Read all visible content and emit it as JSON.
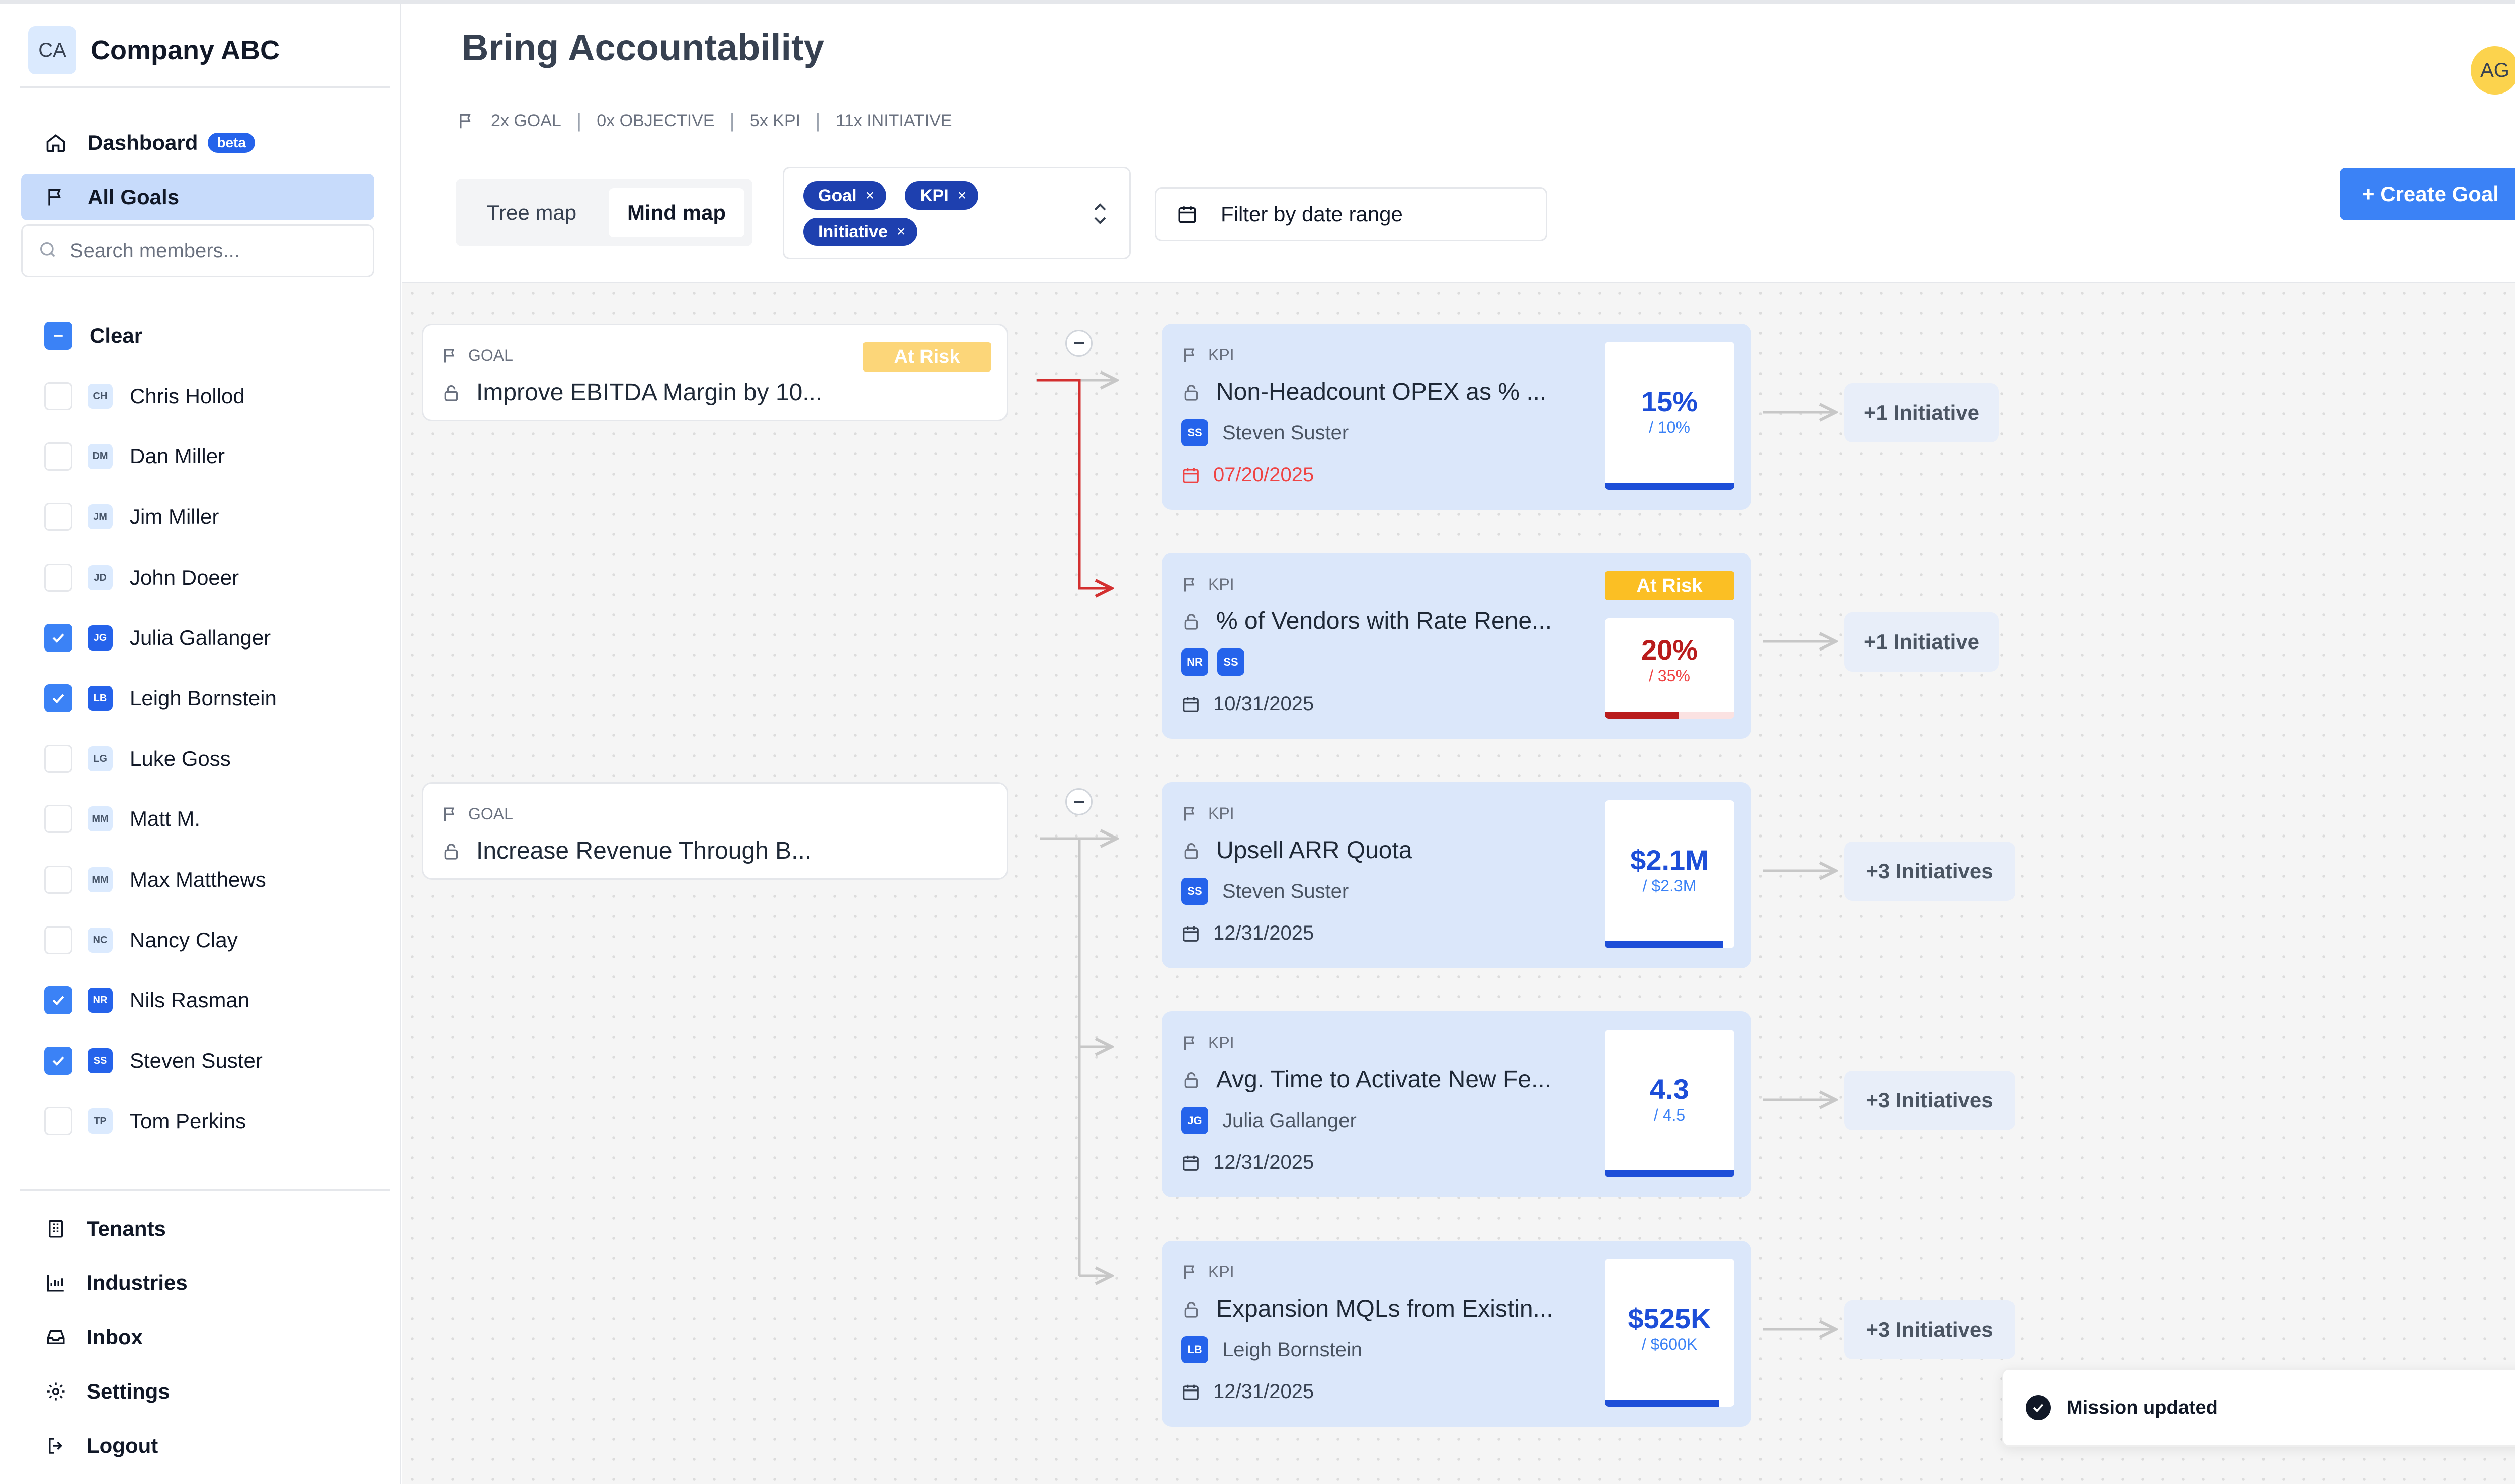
{
  "sidebar": {
    "brand_initials": "CA",
    "brand_name": "Company ABC",
    "nav": [
      {
        "label": "Dashboard",
        "badge": "beta",
        "icon": "home-icon"
      },
      {
        "label": "All Goals",
        "icon": "flag-icon",
        "active": true
      }
    ],
    "search_placeholder": "Search members...",
    "clear_label": "Clear",
    "members": [
      {
        "initials": "CH",
        "name": "Chris Hollod",
        "checked": false
      },
      {
        "initials": "DM",
        "name": "Dan Miller",
        "checked": false
      },
      {
        "initials": "JM",
        "name": "Jim Miller",
        "checked": false
      },
      {
        "initials": "JD",
        "name": "John Doeer",
        "checked": false
      },
      {
        "initials": "JG",
        "name": "Julia Gallanger",
        "checked": true
      },
      {
        "initials": "LB",
        "name": "Leigh Bornstein",
        "checked": true
      },
      {
        "initials": "LG",
        "name": "Luke Goss",
        "checked": false
      },
      {
        "initials": "MM",
        "name": "Matt M.",
        "checked": false
      },
      {
        "initials": "MM",
        "name": "Max Matthews",
        "checked": false
      },
      {
        "initials": "NC",
        "name": "Nancy Clay",
        "checked": false
      },
      {
        "initials": "NR",
        "name": "Nils Rasman",
        "checked": true
      },
      {
        "initials": "SS",
        "name": "Steven Suster",
        "checked": true
      },
      {
        "initials": "TP",
        "name": "Tom Perkins",
        "checked": false
      }
    ],
    "bottom_nav": [
      {
        "label": "Tenants",
        "icon": "building-icon"
      },
      {
        "label": "Industries",
        "icon": "chart-icon"
      },
      {
        "label": "Inbox",
        "icon": "inbox-icon"
      },
      {
        "label": "Settings",
        "icon": "gear-icon"
      },
      {
        "label": "Logout",
        "icon": "logout-icon"
      }
    ]
  },
  "header": {
    "title": "Bring Accountability",
    "counts": [
      "2x GOAL",
      "0x OBJECTIVE",
      "5x KPI",
      "11x INITIATIVE"
    ],
    "user_initials": "AG"
  },
  "toolbar": {
    "views": [
      "Tree map",
      "Mind map"
    ],
    "active_view": "Mind map",
    "type_chips": [
      "Goal",
      "KPI",
      "Initiative"
    ],
    "chip_remove": "×",
    "date_placeholder": "Filter by date range",
    "create_label": "+ Create Goal"
  },
  "goals": [
    {
      "type": "GOAL",
      "title": "Improve EBITDA Margin by 10...",
      "status": "At Risk",
      "status_color": "#fcd679"
    },
    {
      "type": "GOAL",
      "title": "Increase Revenue Through B..."
    }
  ],
  "kpis": [
    {
      "type": "KPI",
      "title": "Non-Headcount OPEX as % ...",
      "owners": [
        {
          "initials": "SS",
          "name": "Steven Suster"
        }
      ],
      "due": "07/20/2025",
      "overdue": true,
      "value": "15%",
      "target": "/ 10%",
      "progress": 1.0,
      "tone": "blue",
      "initiatives": "+1 Initiative"
    },
    {
      "type": "KPI",
      "title": "% of Vendors with Rate Rene...",
      "owners": [
        {
          "initials": "NR"
        },
        {
          "initials": "SS"
        }
      ],
      "due": "10/31/2025",
      "status": "At Risk",
      "value": "20%",
      "target": "/ 35%",
      "progress": 0.57,
      "tone": "red",
      "initiatives": "+1 Initiative"
    },
    {
      "type": "KPI",
      "title": "Upsell ARR Quota",
      "owners": [
        {
          "initials": "SS",
          "name": "Steven Suster"
        }
      ],
      "due": "12/31/2025",
      "value": "$2.1M",
      "target": "/ $2.3M",
      "progress": 0.91,
      "tone": "blue",
      "initiatives": "+3 Initiatives"
    },
    {
      "type": "KPI",
      "title": "Avg. Time to Activate New Fe...",
      "owners": [
        {
          "initials": "JG",
          "name": "Julia Gallanger"
        }
      ],
      "due": "12/31/2025",
      "value": "4.3",
      "target": "/ 4.5",
      "progress": 1.0,
      "tone": "blue",
      "initiatives": "+3 Initiatives"
    },
    {
      "type": "KPI",
      "title": "Expansion MQLs from Existin...",
      "owners": [
        {
          "initials": "LB",
          "name": "Leigh Bornstein"
        }
      ],
      "due": "12/31/2025",
      "value": "$525K",
      "target": "/ $600K",
      "progress": 0.88,
      "tone": "blue",
      "initiatives": "+3 Initiatives"
    }
  ],
  "colors": {
    "accent": "#3b82f6",
    "at_risk": "#fbbf24",
    "danger": "#b91c1c",
    "blue_value": "#1d4ed8"
  },
  "toast": {
    "message": "Mission updated"
  }
}
